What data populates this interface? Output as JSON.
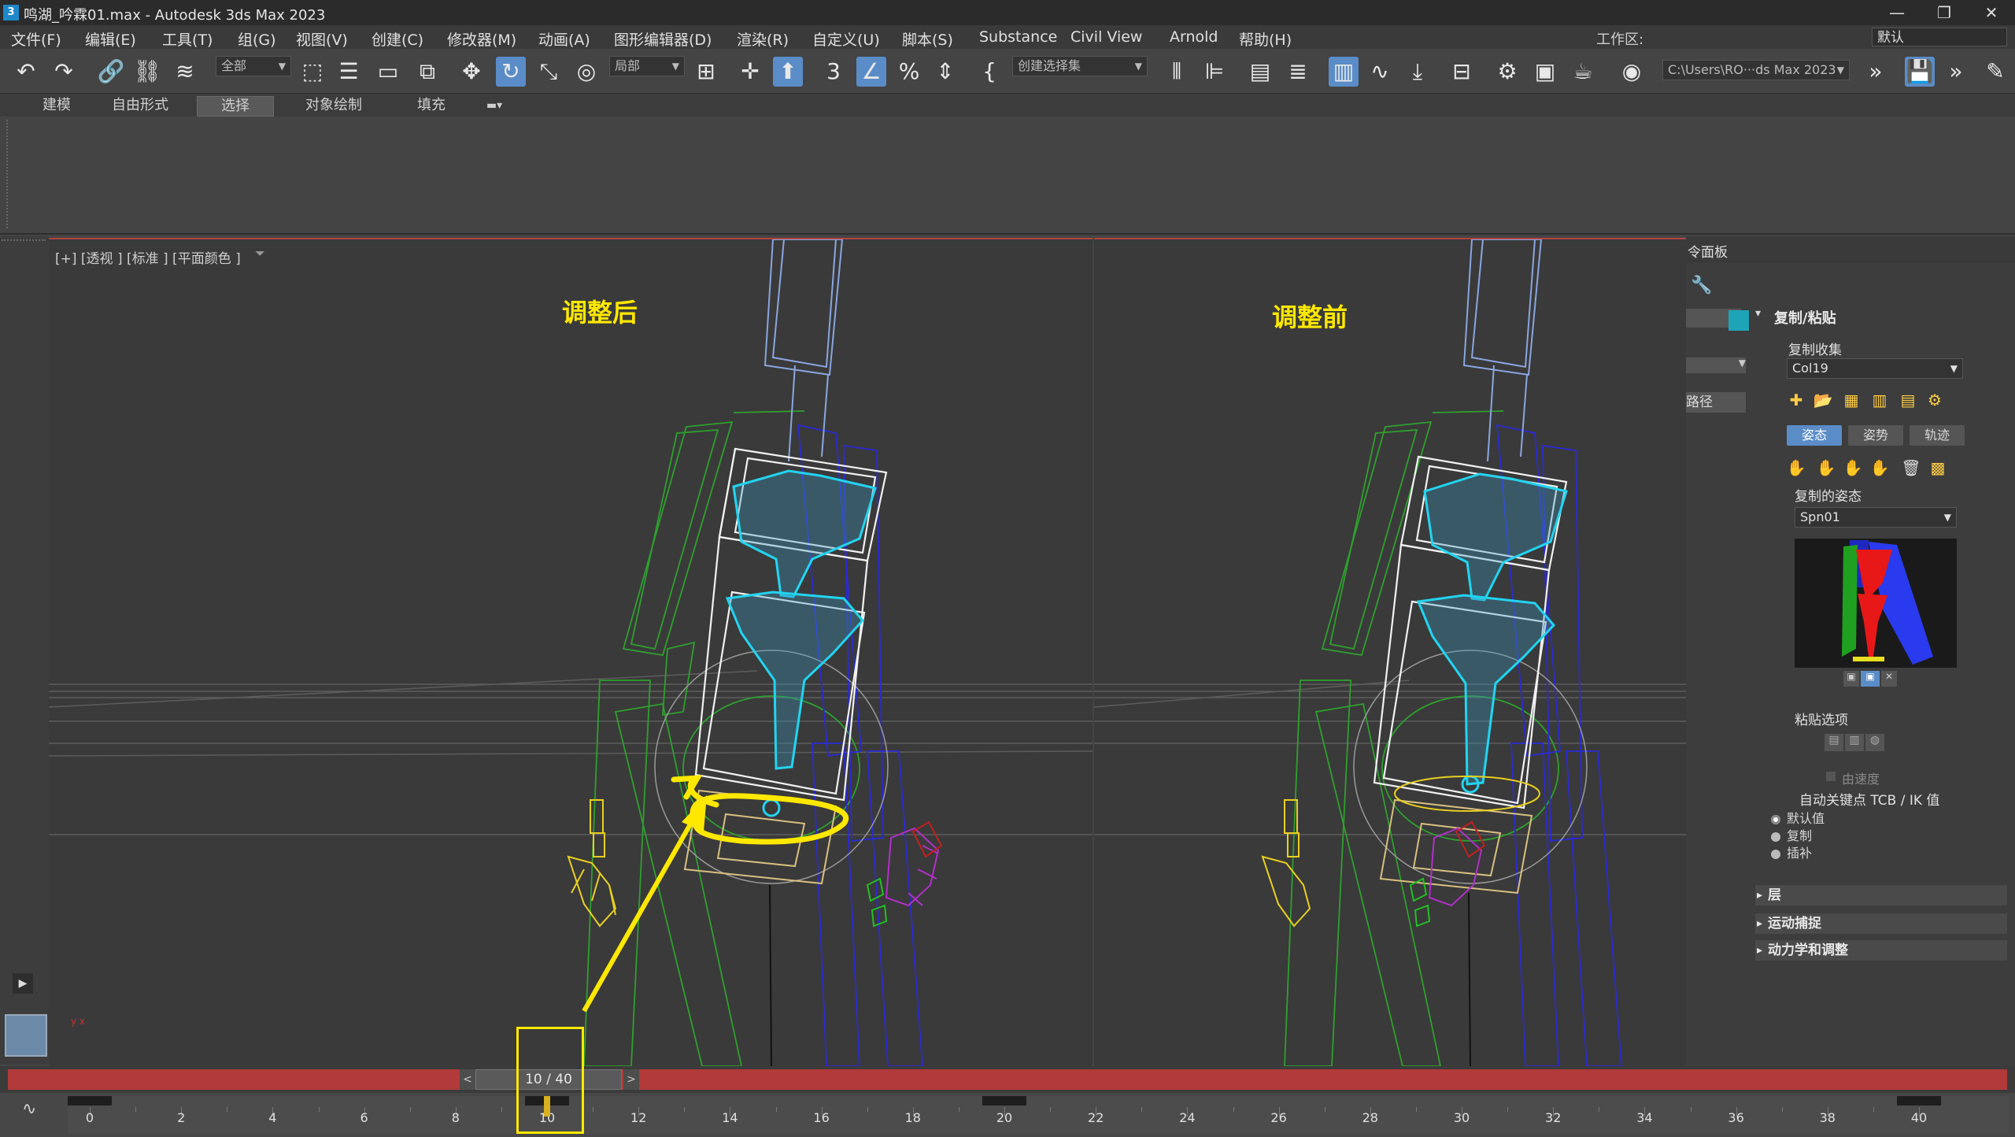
{
  "window": {
    "title": "鸣湖_吟霖01.max - Autodesk 3ds Max 2023",
    "app_icon": "3",
    "controls": [
      "minimize-icon",
      "maximize-icon",
      "close-icon"
    ]
  },
  "menubar": {
    "items": [
      "文件(F)",
      "编辑(E)",
      "工具(T)",
      "组(G)",
      "视图(V)",
      "创建(C)",
      "修改器(M)",
      "动画(A)",
      "图形编辑器(D)",
      "渲染(R)",
      "自定义(U)",
      "脚本(S)",
      "Substance",
      "Civil View",
      "Arnold",
      "帮助(H)"
    ],
    "workspace_label": "工作区:",
    "workspace_value": "默认"
  },
  "toolbar": {
    "filter_value": "全部",
    "coord_value": "局部",
    "selection_set_placeholder": "创建选择集",
    "project_path": "C:\\Users\\RO···ds Max 2023"
  },
  "ribbon": {
    "tabs": [
      "建模",
      "自由形式",
      "选择",
      "对象绘制",
      "填充"
    ],
    "active_tab": "选择"
  },
  "viewport_left": {
    "label": "[+] [透视 ] [标准 ] [平面颜色 ]",
    "annotation": "调整后"
  },
  "viewport_right": {
    "annotation": "调整前"
  },
  "command_panel": {
    "title": "令面板",
    "partial_label": "路径",
    "rollout_copy_paste": "复制/粘贴",
    "copy_collection_label": "复制收集",
    "copy_collection_value": "Col19",
    "mode_buttons": [
      "姿态",
      "姿势",
      "轨迹"
    ],
    "active_mode": "姿态",
    "copied_pose_label": "复制的姿态",
    "copied_pose_value": "Spn01",
    "paste_options_label": "粘贴选项",
    "velocity_label": "由速度",
    "auto_key_label": "自动关键点 TCB / IK 值",
    "radio_options": [
      "默认值",
      "复制",
      "插补"
    ],
    "radio_selected": "默认值",
    "rollouts": [
      "层",
      "运动捕捉",
      "动力学和调整"
    ],
    "swatch_color": "#1fa3b8"
  },
  "timeline": {
    "current_frame": "10 / 40",
    "tick_labels": [
      "0",
      "2",
      "4",
      "6",
      "8",
      "10",
      "12",
      "14",
      "16",
      "18",
      "20",
      "22",
      "24",
      "26",
      "28",
      "30",
      "32",
      "34",
      "36",
      "38",
      "40"
    ],
    "start": 0,
    "end": 40,
    "current": 10,
    "keys": [
      0,
      10,
      20,
      40
    ]
  },
  "colors": {
    "highlight": "#ffe800",
    "timeline_red": "#b23a3a",
    "active_blue": "#5a8cc7"
  }
}
